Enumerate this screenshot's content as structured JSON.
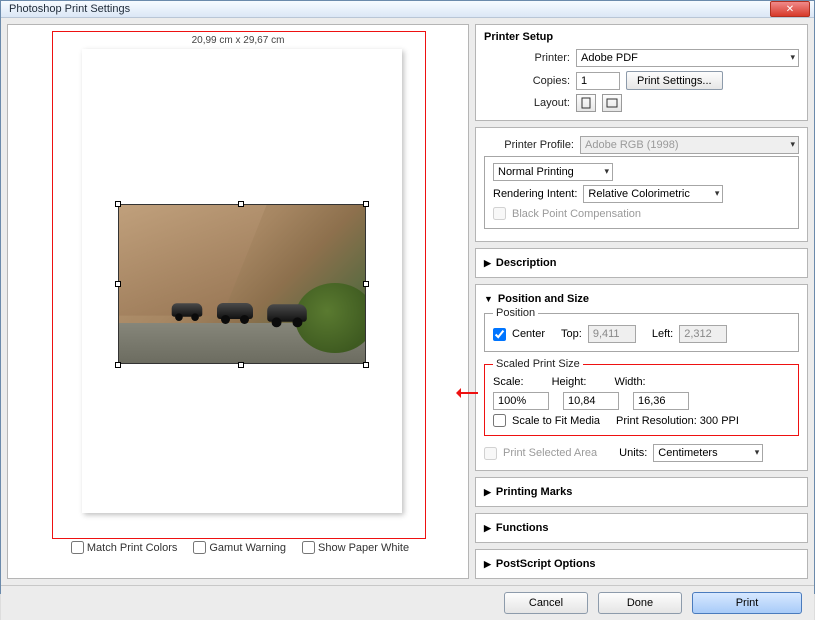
{
  "window": {
    "title": "Photoshop Print Settings"
  },
  "preview": {
    "page_dimensions": "20,99 cm x 29,67 cm",
    "footer": {
      "match_colors": "Match Print Colors",
      "gamut_warning": "Gamut Warning",
      "show_paper_white": "Show Paper White"
    }
  },
  "printer_setup": {
    "heading": "Printer Setup",
    "printer_lbl": "Printer:",
    "printer_value": "Adobe PDF",
    "copies_lbl": "Copies:",
    "copies_value": "1",
    "print_settings_btn": "Print Settings...",
    "layout_lbl": "Layout:"
  },
  "profile": {
    "label": "Printer Profile:",
    "value": "Adobe RGB (1998)",
    "mode": "Normal Printing",
    "intent_lbl": "Rendering Intent:",
    "intent_value": "Relative Colorimetric",
    "bpc_label": "Black Point Compensation"
  },
  "sections": {
    "description": "Description",
    "position_size": "Position and Size",
    "printing_marks": "Printing Marks",
    "functions": "Functions",
    "postscript": "PostScript Options"
  },
  "position": {
    "legend": "Position",
    "center": "Center",
    "top_lbl": "Top:",
    "top_value": "9,411",
    "left_lbl": "Left:",
    "left_value": "2,312"
  },
  "scaled": {
    "legend": "Scaled Print Size",
    "scale_lbl": "Scale:",
    "scale_value": "100%",
    "height_lbl": "Height:",
    "height_value": "10,84",
    "width_lbl": "Width:",
    "width_value": "16,36",
    "fit_media": "Scale to Fit Media",
    "resolution": "Print Resolution: 300 PPI"
  },
  "extra": {
    "print_selected": "Print Selected Area",
    "units_lbl": "Units:",
    "units_value": "Centimeters"
  },
  "buttons": {
    "cancel": "Cancel",
    "done": "Done",
    "print": "Print"
  }
}
